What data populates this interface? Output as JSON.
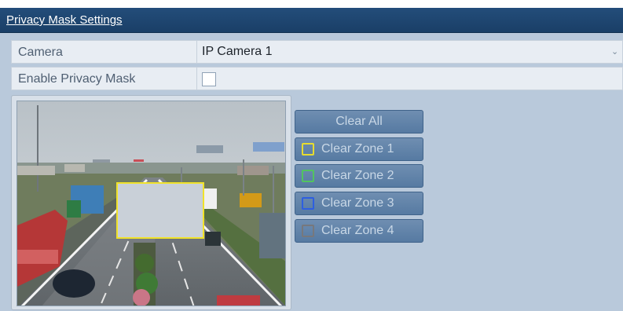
{
  "header": {
    "title": "Privacy Mask Settings"
  },
  "camera_row": {
    "label": "Camera",
    "value": "IP Camera 1"
  },
  "enable_row": {
    "label": "Enable Privacy Mask",
    "checked": false
  },
  "buttons": {
    "clear_all": "Clear All",
    "zones": [
      {
        "label": "Clear Zone 1",
        "color": "#e7dc2f"
      },
      {
        "label": "Clear Zone 2",
        "color": "#52c45f"
      },
      {
        "label": "Clear Zone 3",
        "color": "#2e5fe0"
      },
      {
        "label": "Clear Zone 4",
        "color": "#77787c"
      }
    ]
  },
  "preview": {
    "active_zone_color": "#f0e22a"
  },
  "icons": {
    "dropdown": "chevron-down-icon"
  }
}
